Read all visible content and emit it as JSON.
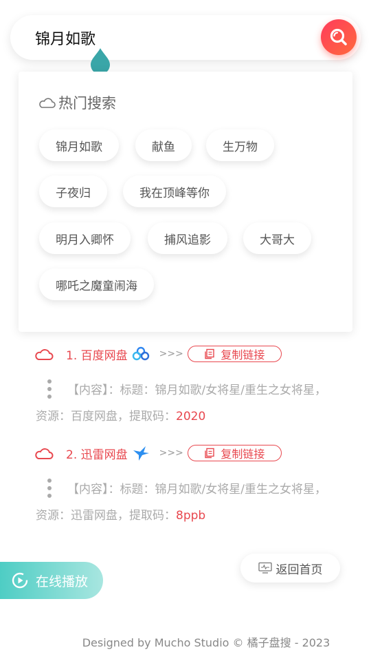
{
  "search": {
    "value": "锦月如歌"
  },
  "hot": {
    "title": "热门搜索",
    "chips": [
      "锦月如歌",
      "献鱼",
      "生万物",
      "子夜归",
      "我在顶峰等你",
      "明月入卿怀",
      "捕风追影",
      "大哥大",
      "哪吒之魔童闹海"
    ]
  },
  "results": [
    {
      "name": "1. 百度网盘",
      "arrows": ">>>",
      "copy_label": "复制链接",
      "desc_line1": "【内容】：标题：锦月如歌/女将星/重生之女将星，",
      "desc_line2": "资源：百度网盘，提取码：",
      "code": "2020",
      "brand_icon": "baidu-netdisk-icon"
    },
    {
      "name": "2. 迅雷网盘",
      "arrows": ">>>",
      "copy_label": "复制链接",
      "desc_line1": "【内容】：标题：锦月如歌/女将星/重生之女将星，",
      "desc_line2": "资源：迅雷网盘，提取码：",
      "code": "8ppb",
      "brand_icon": "xunlei-bird-icon"
    }
  ],
  "buttons": {
    "play": "在线播放",
    "home": "返回首页"
  },
  "footer": "Designed by Mucho Studio © 橘子盘搜 - 2023",
  "colors": {
    "accent_red": "#e8474e",
    "teal": "#4ecdc4",
    "search_gradient": "#ff3b5c"
  }
}
